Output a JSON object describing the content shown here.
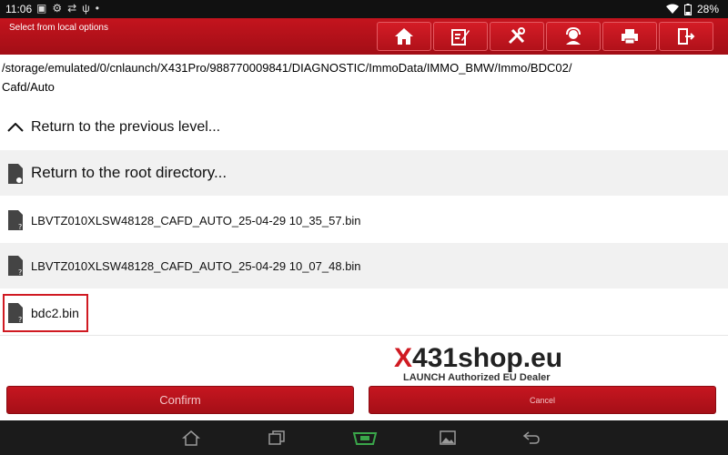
{
  "status": {
    "time": "11:06",
    "battery": "28%"
  },
  "header": {
    "title": "Select from local options"
  },
  "path": {
    "line1": "/storage/emulated/0/cnlaunch/X431Pro/988770009841/DIAGNOSTIC/ImmoData/IMMO_BMW/Immo/BDC02/",
    "line2": "Cafd/Auto"
  },
  "list": {
    "prev": "Return to the previous level...",
    "root": "Return to the root directory...",
    "files": [
      "LBVTZ010XLSW48128_CAFD_AUTO_25-04-29 10_35_57.bin",
      "LBVTZ010XLSW48128_CAFD_AUTO_25-04-29 10_07_48.bin",
      "bdc2.bin"
    ]
  },
  "watermark": {
    "brand_red": "X",
    "brand_dark": "431shop.eu",
    "subtitle": "LAUNCH Authorized EU Dealer"
  },
  "buttons": {
    "confirm": "Confirm",
    "cancel": "Cancel"
  },
  "colors": {
    "header_red": "#c4141e",
    "highlight": "#d01a22"
  }
}
